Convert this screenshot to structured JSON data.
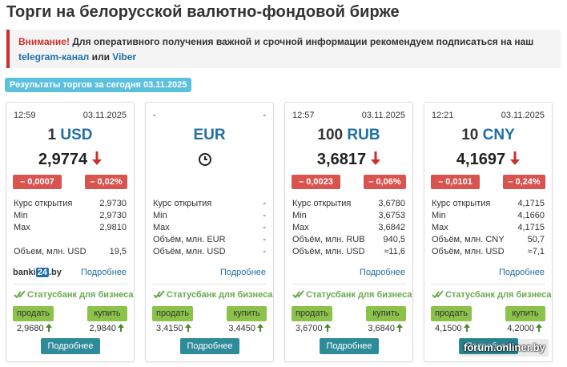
{
  "page": {
    "title": "Торги на белорусской валютно-фондовой бирже"
  },
  "notice": {
    "warning_label": "Внимание!",
    "text": " Для оперативного получения важной и срочной информации рекомендуем подписаться на наш ",
    "telegram_link": "telegram-канал",
    "or": " или ",
    "viber_link": "Viber"
  },
  "results_badge": "Результаты торгов за сегодня 03.11.2025",
  "labels": {
    "open": "Курс открытия",
    "min": "Min",
    "max": "Max",
    "more": "Подробнее",
    "statusbank": "Статусбанк",
    "for_business": "для бизнеса",
    "sell": "продать",
    "buy": "купить",
    "banki_left": "banki",
    "banki_num": "24",
    "banki_right": ".by"
  },
  "colors": {
    "accent": "#1f6fa8",
    "negative": "#d9534f",
    "buy_sell": "#8bc34a",
    "more_button": "#2e8b9a",
    "badge": "#5bc0de"
  },
  "cards": [
    {
      "time": "12:59",
      "date": "03.11.2025",
      "amount": "1",
      "code": "USD",
      "rate": "2,9774",
      "trend": "down",
      "change_abs": "– 0,0007",
      "change_pct": "– 0,02%",
      "open": "2,9730",
      "min": "2,9730",
      "max": "2,9810",
      "extra_rows": [
        {
          "label": "Объем, млн. USD",
          "value": "19,5"
        }
      ],
      "sell_price": "2,9680",
      "buy_price": "2,9840"
    },
    {
      "time": "-",
      "date": "-",
      "amount": "",
      "code": "EUR",
      "rate": "",
      "trend": "clock",
      "change_abs": "",
      "change_pct": "",
      "open": "-",
      "min": "-",
      "max": "-",
      "extra_rows": [
        {
          "label": "Объём, млн. EUR",
          "value": "-"
        },
        {
          "label": "Объём, млн. USD",
          "value": "-"
        }
      ],
      "sell_price": "3,4150",
      "buy_price": "3,4450"
    },
    {
      "time": "12:57",
      "date": "03.11.2025",
      "amount": "100",
      "code": "RUB",
      "rate": "3,6817",
      "trend": "down",
      "change_abs": "– 0,0023",
      "change_pct": "– 0,06%",
      "open": "3,6780",
      "min": "3,6753",
      "max": "3,6842",
      "extra_rows": [
        {
          "label": "Объём, млн. RUB",
          "value": "940,5"
        },
        {
          "label": "Объём, млн. USD",
          "value": "≈11,6"
        }
      ],
      "sell_price": "3,6700",
      "buy_price": "3,6840"
    },
    {
      "time": "12:21",
      "date": "03.11.2025",
      "amount": "10",
      "code": "CNY",
      "rate": "4,1697",
      "trend": "down",
      "change_abs": "– 0,0101",
      "change_pct": "– 0,24%",
      "open": "4,1715",
      "min": "4,1660",
      "max": "4,1715",
      "extra_rows": [
        {
          "label": "Объём, млн. CNY",
          "value": "50,7"
        },
        {
          "label": "Объём, млн. USD",
          "value": "≈7,1"
        }
      ],
      "sell_price": "4,1500",
      "buy_price": "4,2000"
    }
  ],
  "watermark": "forum.onliner.by"
}
